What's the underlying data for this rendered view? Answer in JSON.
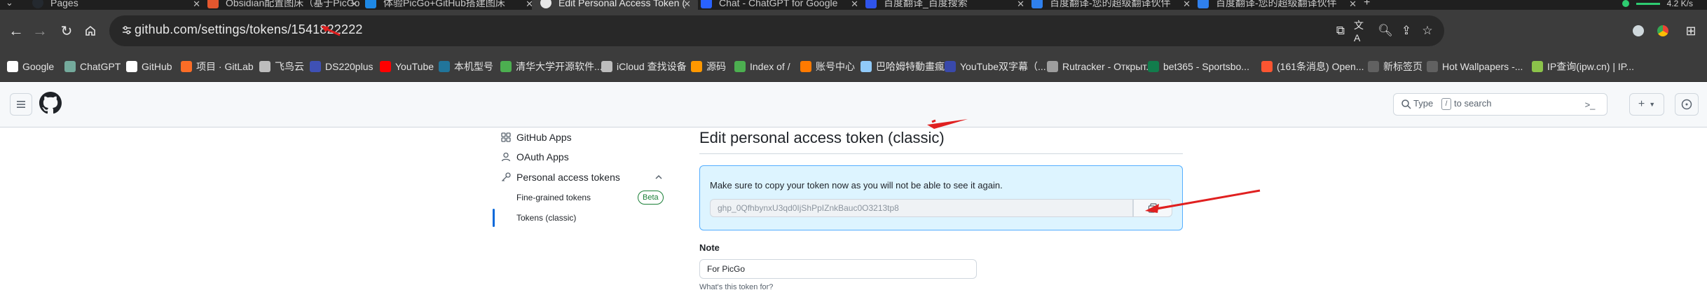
{
  "browser": {
    "tabs": [
      {
        "title": "Pages",
        "color": "#24292f"
      },
      {
        "title": "Obsidian配置图床（基于PicGo",
        "color": "#e4572e"
      },
      {
        "title": "体验PicGo+GitHub搭建图床",
        "color": "#1e88e5"
      },
      {
        "title": "Edit Personal Access Token (",
        "color": "#24292f"
      },
      {
        "title": "Chat - ChatGPT for Google",
        "color": "#2962ff"
      },
      {
        "title": "百度翻译_百度搜索",
        "color": "#2f54eb"
      },
      {
        "title": "百度翻译-您的超级翻译伙伴",
        "color": "#2f80ed"
      },
      {
        "title": "百度翻译-您的超级翻译伙伴",
        "color": "#2f80ed"
      }
    ],
    "network_speed": "4.2 K/s",
    "new_tab_label": "+",
    "url": "github.com/settings/tokens/1541822222"
  },
  "bookmarks": [
    {
      "label": "Google",
      "icon": "google-icon",
      "color": "#ffffff"
    },
    {
      "label": "ChatGPT",
      "icon": "chatgpt-icon",
      "color": "#74aa9c"
    },
    {
      "label": "GitHub",
      "icon": "github-icon",
      "color": "#ffffff"
    },
    {
      "label": "项目 · GitLab",
      "icon": "gitlab-icon",
      "color": "#fc6d26"
    },
    {
      "label": "飞鸟云",
      "icon": "feiniaoyun-icon",
      "color": "#bdbdbd"
    },
    {
      "label": "DS220plus",
      "icon": "dsm-icon",
      "color": "#3f51b5"
    },
    {
      "label": "YouTube",
      "icon": "youtube-icon",
      "color": "#ff0000"
    },
    {
      "label": "本机型号",
      "icon": "wordpress-icon",
      "color": "#21759b"
    },
    {
      "label": "清华大学开源软件...",
      "icon": "tuna-icon",
      "color": "#4caf50"
    },
    {
      "label": "iCloud 查找设备",
      "icon": "apple-icon",
      "color": "#bdbdbd"
    },
    {
      "label": "源码",
      "icon": "source-icon",
      "color": "#ff9800"
    },
    {
      "label": "Index of /",
      "icon": "globe-icon",
      "color": "#4caf50"
    },
    {
      "label": "账号中心",
      "icon": "account-icon",
      "color": "#ff7a00"
    },
    {
      "label": "巴哈姆特動畫瘋",
      "icon": "bahamut-icon",
      "color": "#90caf9"
    },
    {
      "label": "YouTube双字幕（...",
      "icon": "subtitle-icon",
      "color": "#3949ab"
    },
    {
      "label": "Rutracker - Открыт...",
      "icon": "rutracker-icon",
      "color": "#9e9e9e"
    },
    {
      "label": "bet365 - Sportsbo...",
      "icon": "bet365-icon",
      "color": "#127c4c"
    },
    {
      "label": "(161条消息) Open...",
      "icon": "csdn-icon",
      "color": "#fc5531"
    },
    {
      "label": "新标签页",
      "icon": "newtab-icon",
      "color": "#616161"
    },
    {
      "label": "Hot Wallpapers -...",
      "icon": "wallpaper-icon",
      "color": "#616161"
    },
    {
      "label": "IP查询(ipw.cn) | IP...",
      "icon": "ipw-icon",
      "color": "#8bc34a"
    }
  ],
  "github": {
    "search_placeholder_left": "Type",
    "search_slash": "/",
    "search_placeholder_right": "to search",
    "create_label": "+",
    "cmd_palette_label": ">_"
  },
  "sidebar": {
    "items": [
      {
        "label": "GitHub Apps",
        "icon": "apps-grid-icon"
      },
      {
        "label": "OAuth Apps",
        "icon": "person-icon"
      },
      {
        "label": "Personal access tokens",
        "icon": "key-icon"
      }
    ],
    "sub_items": [
      {
        "label": "Fine-grained tokens",
        "badge": "Beta"
      },
      {
        "label": "Tokens (classic)",
        "selected": true
      }
    ]
  },
  "main": {
    "title": "Edit personal access token (classic)",
    "flash_message": "Make sure to copy your token now as you will not be able to see it again.",
    "token_value": "ghp_0QfhbynxU3qd0IjShPpIZnkBauc0O3213tp8",
    "note_label": "Note",
    "note_value": "For PicGo",
    "note_hint": "What's this token for?"
  },
  "colors": {
    "accent": "#0969da",
    "flash_bg": "#ddf4ff",
    "flash_border": "#54aeff",
    "beta_green": "#1a7f37",
    "annotation_red": "#e02020"
  }
}
